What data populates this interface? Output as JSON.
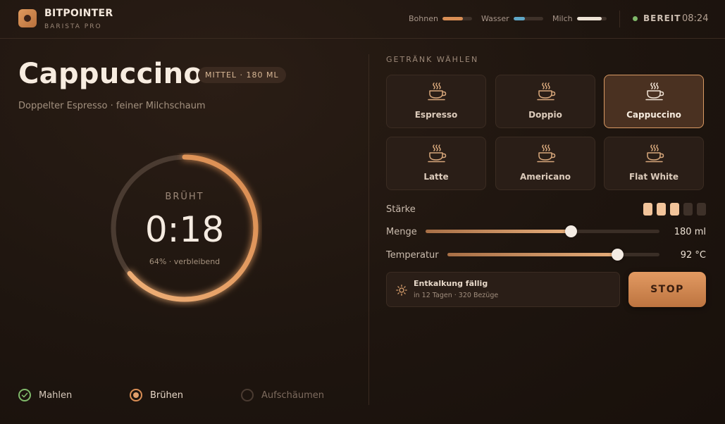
{
  "header": {
    "brand": "BITPOINTER",
    "brand_sub": "BARISTA PRO",
    "levels": [
      {
        "label": "Bohnen",
        "fraction": 0.7,
        "color": "#d98e55"
      },
      {
        "label": "Wasser",
        "fraction": 0.4,
        "color": "#5fa7c7"
      },
      {
        "label": "Milch",
        "fraction": 0.85,
        "color": "#ede3d6"
      }
    ],
    "status": "BEREIT",
    "time": "08:24"
  },
  "brew": {
    "title": "Cappuccino",
    "size_badge": "MITTEL · 180 ML",
    "subtitle": "Doppelter Espresso · feiner Milchschaum",
    "state_label": "BRÜHT",
    "timer": "0:18",
    "remaining": "64% · verbleibend",
    "progress_fraction": 0.64
  },
  "steps": [
    {
      "label": "Mahlen",
      "state": "done"
    },
    {
      "label": "Brühen",
      "state": "active"
    },
    {
      "label": "Aufschäumen",
      "state": "pending"
    }
  ],
  "drinks": {
    "section_title": "GETRÄNK WÄHLEN",
    "items": [
      {
        "name": "Espresso",
        "icon": "coffee-cup-icon",
        "active": false
      },
      {
        "name": "Doppio",
        "icon": "coffee-cup-icon",
        "active": false
      },
      {
        "name": "Cappuccino",
        "icon": "coffee-cup-icon",
        "active": true
      },
      {
        "name": "Latte",
        "icon": "coffee-cup-icon",
        "active": false
      },
      {
        "name": "Americano",
        "icon": "coffee-cup-icon",
        "active": false
      },
      {
        "name": "Flat White",
        "icon": "coffee-cup-icon",
        "active": false
      }
    ]
  },
  "settings": {
    "strength_label": "Stärke",
    "strength_level": 3,
    "strength_max": 5,
    "amount_label": "Menge",
    "amount_value": "180 ml",
    "amount_fraction": 0.62,
    "temp_label": "Temperatur",
    "temp_value": "92 °C",
    "temp_fraction": 0.8
  },
  "notice": {
    "title": "Entkalkung fällig",
    "detail": "in 12 Tagen · 320 Bezüge",
    "icon": "sun-icon"
  },
  "stop_label": "STOP",
  "colors": {
    "accent": "#d98e55",
    "done_green": "#7fb86a"
  }
}
